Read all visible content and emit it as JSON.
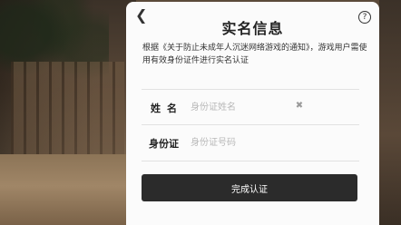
{
  "dialog": {
    "back_icon": "chevron-left-icon",
    "title": "实名信息",
    "help_label": "?",
    "notice": "根据《关于防止未成年人沉迷网络游戏的通知》，游戏用户需使用有效身份证件进行实名认证",
    "name_field": {
      "label": "姓名",
      "placeholder": "身份证姓名",
      "value": ""
    },
    "id_field": {
      "label": "身份证",
      "placeholder": "身份证号码",
      "value": ""
    },
    "clear_icon": "close-icon",
    "submit_label": "完成认证"
  }
}
